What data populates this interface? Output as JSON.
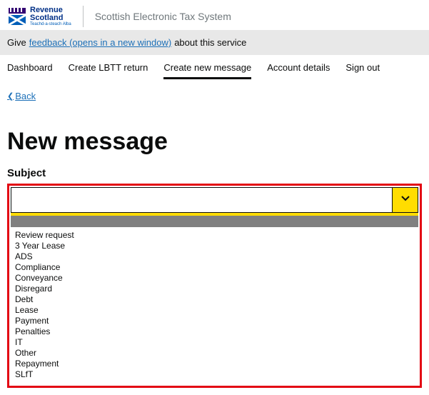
{
  "header": {
    "logo_line1": "Revenue",
    "logo_line2": "Scotland",
    "logo_tagline": "Teachd-a-steach Alba",
    "system_name": "Scottish Electronic Tax System"
  },
  "feedback": {
    "prefix": "Give",
    "link_text": "feedback (opens in a new window)",
    "suffix": "about this service"
  },
  "nav": {
    "items": [
      {
        "label": "Dashboard",
        "active": false
      },
      {
        "label": "Create LBTT return",
        "active": false
      },
      {
        "label": "Create new message",
        "active": true
      },
      {
        "label": "Account details",
        "active": false
      },
      {
        "label": "Sign out",
        "active": false
      }
    ]
  },
  "back": {
    "label": "Back"
  },
  "page": {
    "title": "New message",
    "subject_label": "Subject"
  },
  "subject_select": {
    "value": "",
    "options": [
      "Review request",
      "3 Year Lease",
      "ADS",
      "Compliance",
      "Conveyance",
      "Disregard",
      "Debt",
      "Lease",
      "Payment",
      "Penalties",
      "IT",
      "Other",
      "Repayment",
      "SLfT"
    ]
  }
}
